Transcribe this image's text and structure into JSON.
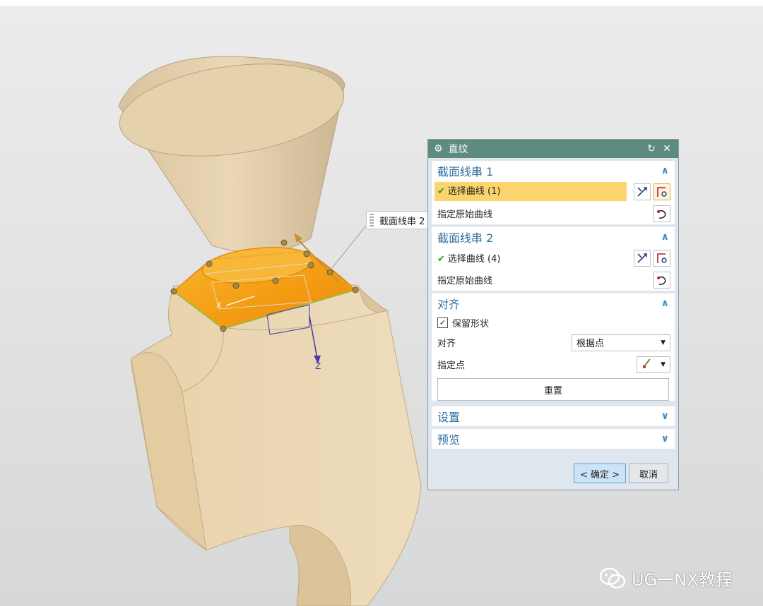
{
  "callout": {
    "label": "截面线串 2"
  },
  "axis_label": "Z",
  "dialog": {
    "title": "直纹",
    "reset_icon": "reset-icon",
    "close_icon": "close-icon",
    "section1": {
      "header": "截面线串 1",
      "select_label": "选择曲线 (1)",
      "origin_label": "指定原始曲线"
    },
    "section2": {
      "header": "截面线串 2",
      "select_label": "选择曲线 (4)",
      "origin_label": "指定原始曲线"
    },
    "align": {
      "header": "对齐",
      "keep_shape_label": "保留形状",
      "keep_shape_checked": true,
      "align_label": "对齐",
      "align_value": "根据点",
      "point_label": "指定点",
      "reset_button": "重置"
    },
    "settings": {
      "header": "设置"
    },
    "preview": {
      "header": "预览"
    },
    "ok_button": "< 确定 >",
    "cancel_button": "取消"
  },
  "watermark": {
    "text": "UG一NX教程",
    "icon": "wechat-icon"
  },
  "colors": {
    "title_bar": "#5d8b7f",
    "section_text": "#2f6e9e",
    "highlight": "#fbd46d",
    "model": "#e9d3ad",
    "selected_face": "#f5a623"
  }
}
